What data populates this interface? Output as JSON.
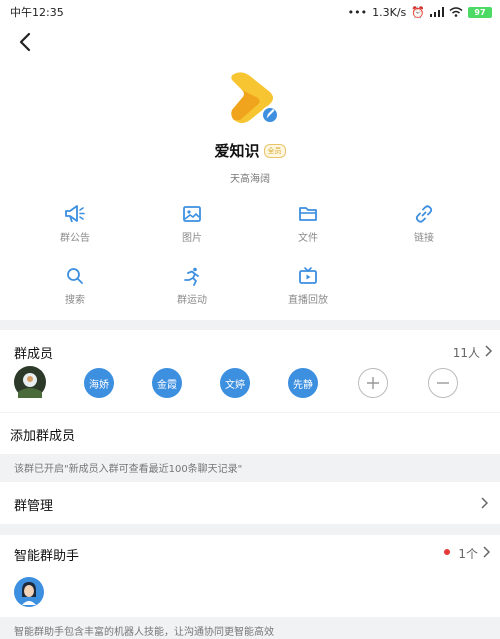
{
  "status_bar": {
    "time": "中午12:35",
    "speed": "1.3K/s",
    "battery": "97"
  },
  "header": {
    "group_name": "爱知识",
    "badge": "全员",
    "description": "天高海阔"
  },
  "functions": [
    {
      "label": "群公告",
      "icon": "megaphone-icon"
    },
    {
      "label": "图片",
      "icon": "image-icon"
    },
    {
      "label": "文件",
      "icon": "folder-icon"
    },
    {
      "label": "链接",
      "icon": "link-icon"
    },
    {
      "label": "搜索",
      "icon": "search-icon"
    },
    {
      "label": "群运动",
      "icon": "running-icon"
    },
    {
      "label": "直播回放",
      "icon": "tv-icon"
    }
  ],
  "members": {
    "title": "群成员",
    "count": "11人",
    "list": [
      "海娇",
      "金霞",
      "文婷",
      "先静"
    ]
  },
  "add_member": {
    "label": "添加群成员",
    "note": "该群已开启\"新成员入群可查看最近100条聊天记录\""
  },
  "manage": {
    "label": "群管理"
  },
  "assistant": {
    "label": "智能群助手",
    "count": "1个",
    "note": "智能群助手包含丰富的机器人技能，让沟通协同更智能高效"
  },
  "colors": {
    "accent": "#3d8fe0",
    "logo_yellow": "#f7c531",
    "red_dot": "#e53935"
  }
}
